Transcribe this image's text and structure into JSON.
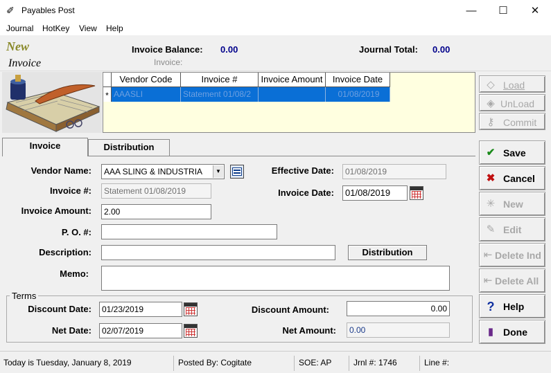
{
  "window": {
    "title": "Payables Post",
    "minimize": "—",
    "maximize": "☐",
    "close": "✕"
  },
  "menu": [
    "Journal",
    "HotKey",
    "View",
    "Help"
  ],
  "header": {
    "mode": "New",
    "doc_type": "Invoice",
    "invoice_balance_label": "Invoice Balance:",
    "invoice_balance_value": "0.00",
    "invoice_label": "Invoice:",
    "journal_total_label": "Journal Total:",
    "journal_total_value": "0.00"
  },
  "grid": {
    "columns": [
      "Vendor Code",
      "Invoice #",
      "Invoice Amount",
      "Invoice Date"
    ],
    "row_marker": "*",
    "rows": [
      {
        "vendor_code": "AAASLI",
        "invoice_no": "Statement 01/08/2",
        "amount": "",
        "date": "01/08/2019"
      }
    ]
  },
  "side_top": {
    "load": "Load",
    "unload": "UnLoad",
    "commit": "Commit"
  },
  "side_actions": {
    "save": "Save",
    "cancel": "Cancel",
    "new": "New",
    "edit": "Edit",
    "delete_ind": "Delete Ind",
    "delete_all": "Delete All",
    "help": "Help",
    "done": "Done"
  },
  "tabs": [
    "Invoice",
    "Distribution"
  ],
  "form": {
    "vendor_name_label": "Vendor Name:",
    "vendor_name_value": "AAA SLING & INDUSTRIA",
    "effective_date_label": "Effective Date:",
    "effective_date_value": "01/08/2019",
    "invoice_no_label": "Invoice #:",
    "invoice_no_value": "Statement 01/08/2019",
    "invoice_date_label": "Invoice Date:",
    "invoice_date_value": "01/08/2019",
    "invoice_amount_label": "Invoice Amount:",
    "invoice_amount_value": "2.00",
    "po_label": "P. O. #:",
    "po_value": "",
    "description_label": "Description:",
    "description_value": "",
    "distribution_button": "Distribution",
    "memo_label": "Memo:",
    "memo_value": ""
  },
  "terms": {
    "legend": "Terms",
    "discount_date_label": "Discount Date:",
    "discount_date_value": "01/23/2019",
    "net_date_label": "Net Date:",
    "net_date_value": "02/07/2019",
    "discount_amount_label": "Discount Amount:",
    "discount_amount_value": "0.00",
    "net_amount_label": "Net Amount:",
    "net_amount_value": "0.00"
  },
  "status": {
    "today": "Today is  Tuesday, January 8, 2019",
    "posted_by": "Posted By: Cogitate",
    "soe": "SOE: AP",
    "jrnl": "Jrnl #: 1746",
    "line": "Line #:"
  },
  "colors": {
    "selection": "#0a6fd6",
    "grid_bg": "#ffffe0",
    "value_blue": "#00008b"
  }
}
